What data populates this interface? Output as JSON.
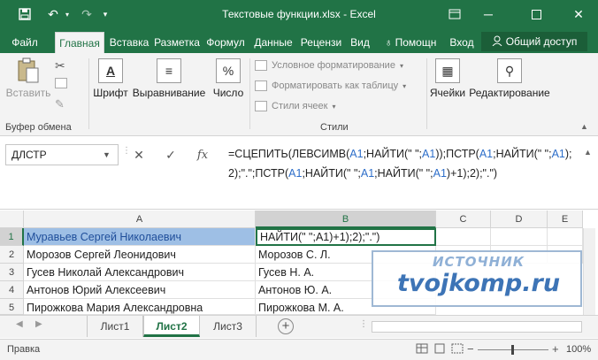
{
  "window": {
    "title": "Текстовые функции.xlsx - Excel"
  },
  "tabs": [
    "Файл",
    "Главная",
    "Вставка",
    "Разметка",
    "Формул",
    "Данные",
    "Рецензи",
    "Вид",
    "Помощн",
    "Вход"
  ],
  "share_label": "Общий доступ",
  "ribbon": {
    "paste": "Вставить",
    "clipboard_group": "Буфер обмена",
    "font": "Шрифт",
    "alignment": "Выравнивание",
    "number": "Число",
    "cond_format": "Условное форматирование",
    "format_table": "Форматировать как таблицу",
    "cell_styles": "Стили ячеек",
    "styles_group": "Стили",
    "cells": "Ячейки",
    "editing": "Редактирование"
  },
  "formula_bar": {
    "name_box": "ДЛСТР",
    "fx": "fx",
    "formula": "=СЦЕПИТЬ(ЛЕВСИМВ(A1;НАЙТИ(\" \";A1));ПСТР(A1;НАЙТИ(\" \";A1);2);\".\";ПСТР(A1;НАЙТИ(\" \";A1;НАЙТИ(\" \";A1)+1);2);\".\")"
  },
  "grid": {
    "columns": [
      "A",
      "B",
      "C",
      "D",
      "E"
    ],
    "rows": [
      {
        "num": "1",
        "a": "Муравьев Сергей Николаевич",
        "b": "НАЙТИ(\" \";A1)+1);2);\".\")"
      },
      {
        "num": "2",
        "a": "Морозов Сергей Леонидович",
        "b": "Морозов  С. Л."
      },
      {
        "num": "3",
        "a": "Гусев Николай Александрович",
        "b": "Гусев  Н. А."
      },
      {
        "num": "4",
        "a": "Антонов Юрий Алексеевич",
        "b": "Антонов  Ю. А."
      },
      {
        "num": "5",
        "a": "Пирожкова Мария Александровна",
        "b": "Пирожкова  М. А."
      }
    ]
  },
  "watermark": {
    "top": "ИСТОЧНИК",
    "main": "tvojkomp.ru"
  },
  "sheets": [
    "Лист1",
    "Лист2",
    "Лист3"
  ],
  "active_sheet": "Лист2",
  "status": {
    "mode": "Правка",
    "zoom": "100%"
  },
  "colors": {
    "accent": "#217346",
    "selection": "#9ebfe5",
    "reference": "#2d6ec9"
  }
}
